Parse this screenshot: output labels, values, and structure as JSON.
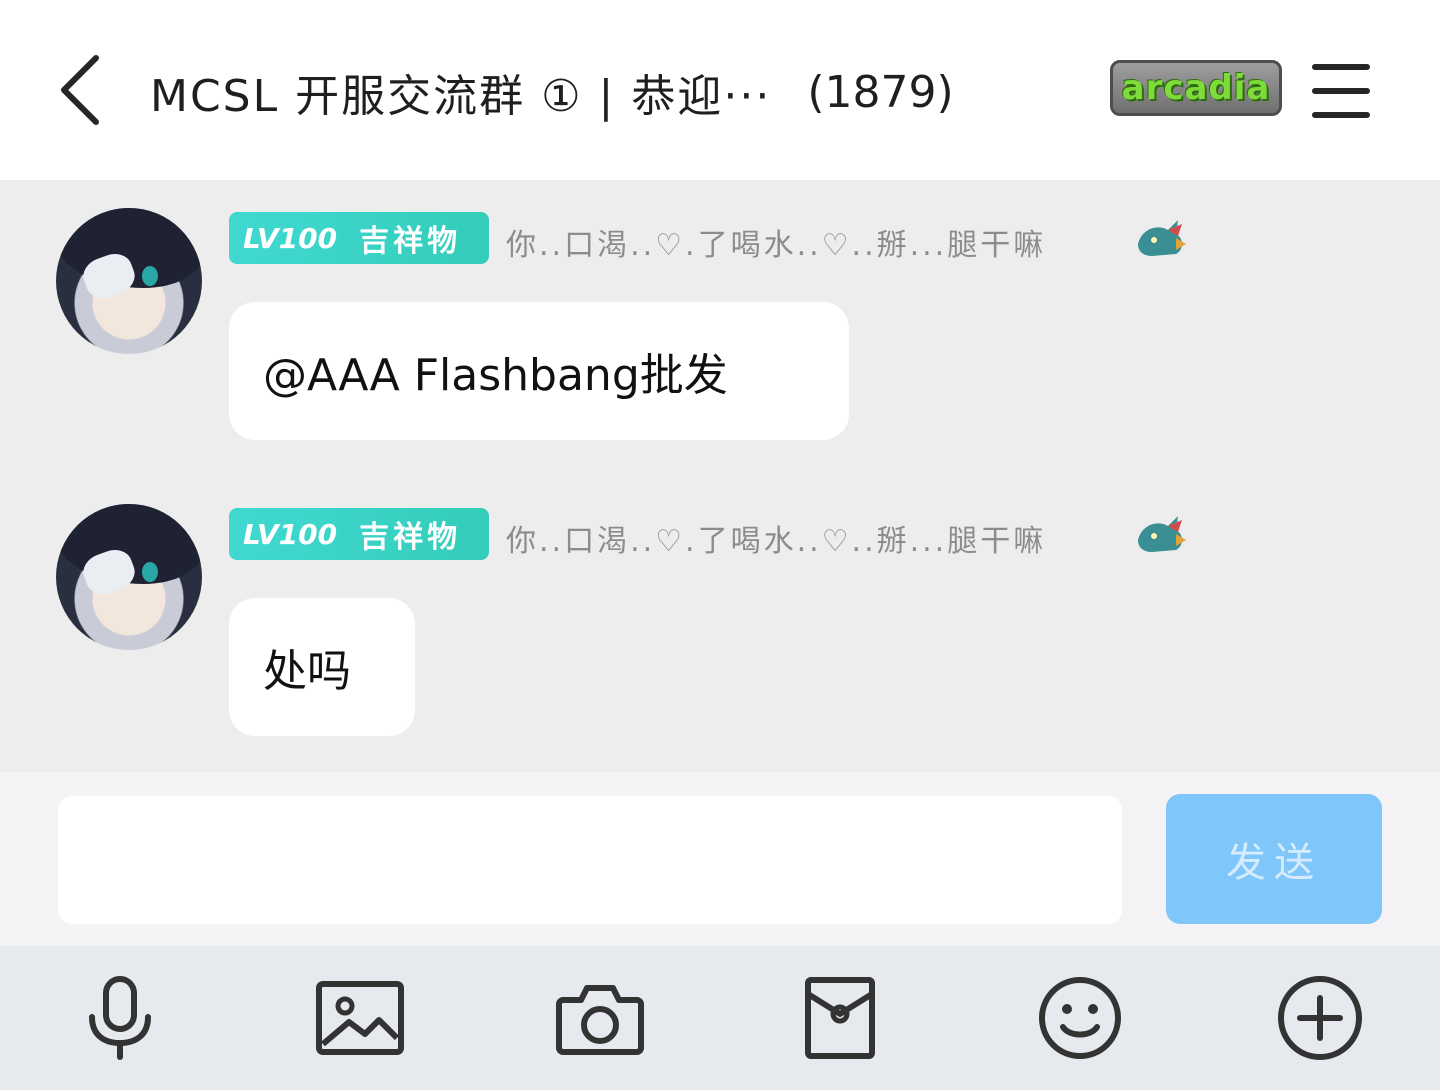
{
  "header": {
    "group_name": "MCSL 开服交流群 ① | 恭迎···",
    "member_count": "(1879)",
    "badge_text": "arcadia"
  },
  "messages": [
    {
      "level": "LV100",
      "level_title": "吉祥物",
      "nickname": "你..口渴..♡.了喝水..♡..掰...腿干嘛",
      "text": "@AAA Flashbang批发"
    },
    {
      "level": "LV100",
      "level_title": "吉祥物",
      "nickname": "你..口渴..♡.了喝水..♡..掰...腿干嘛",
      "text": "处吗"
    }
  ],
  "composer": {
    "value": "",
    "send_label": "发送"
  },
  "toolbar": {
    "icons": [
      "microphone-icon",
      "image-icon",
      "camera-icon",
      "red-packet-icon",
      "emoji-icon",
      "plus-icon"
    ]
  },
  "colors": {
    "chat_bg": "#ededed",
    "level_badge": "#3fd9d2",
    "send_button": "#7fc6fb",
    "toolbar_bg": "#e6eaee"
  }
}
